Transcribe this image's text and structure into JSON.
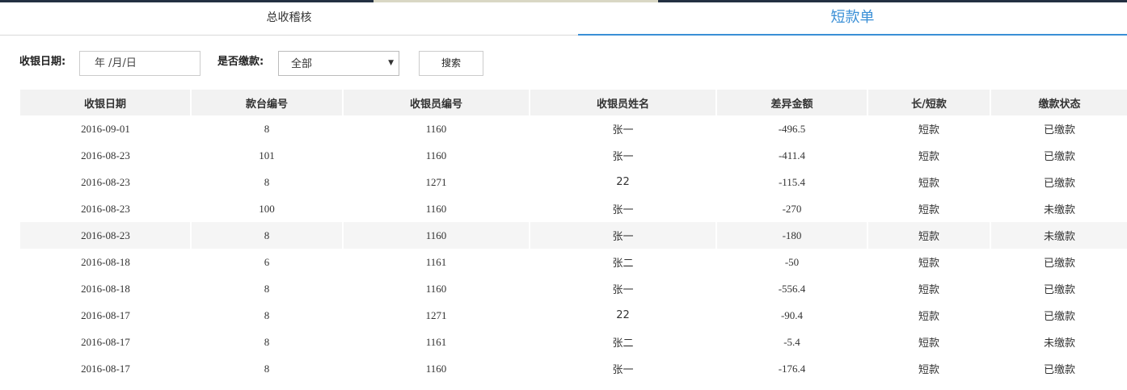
{
  "tabs": [
    {
      "label": "总收稽核",
      "active": false
    },
    {
      "label": "短款单",
      "active": true
    }
  ],
  "filters": {
    "date_label": "收银日期:",
    "date_placeholder": "年 /月/日",
    "pay_label": "是否缴款:",
    "pay_selected": "全部",
    "search_label": "搜索"
  },
  "table": {
    "headers": [
      "收银日期",
      "款台编号",
      "收银员编号",
      "收银员姓名",
      "差异金额",
      "长/短款",
      "缴款状态"
    ],
    "rows": [
      {
        "date": "2016-09-01",
        "counter": "8",
        "cashier_id": "1160",
        "cashier_name": "张一",
        "diff": "-496.5",
        "type": "短款",
        "status": "已缴款"
      },
      {
        "date": "2016-08-23",
        "counter": "101",
        "cashier_id": "1160",
        "cashier_name": "张一",
        "diff": "-411.4",
        "type": "短款",
        "status": "已缴款"
      },
      {
        "date": "2016-08-23",
        "counter": "8",
        "cashier_id": "1271",
        "cashier_name": "22",
        "diff": "-115.4",
        "type": "短款",
        "status": "已缴款"
      },
      {
        "date": "2016-08-23",
        "counter": "100",
        "cashier_id": "1160",
        "cashier_name": "张一",
        "diff": "-270",
        "type": "短款",
        "status": "未缴款"
      },
      {
        "date": "2016-08-23",
        "counter": "8",
        "cashier_id": "1160",
        "cashier_name": "张一",
        "diff": "-180",
        "type": "短款",
        "status": "未缴款"
      },
      {
        "date": "2016-08-18",
        "counter": "6",
        "cashier_id": "1161",
        "cashier_name": "张二",
        "diff": "-50",
        "type": "短款",
        "status": "已缴款"
      },
      {
        "date": "2016-08-18",
        "counter": "8",
        "cashier_id": "1160",
        "cashier_name": "张一",
        "diff": "-556.4",
        "type": "短款",
        "status": "已缴款"
      },
      {
        "date": "2016-08-17",
        "counter": "8",
        "cashier_id": "1271",
        "cashier_name": "22",
        "diff": "-90.4",
        "type": "短款",
        "status": "已缴款"
      },
      {
        "date": "2016-08-17",
        "counter": "8",
        "cashier_id": "1161",
        "cashier_name": "张二",
        "diff": "-5.4",
        "type": "短款",
        "status": "未缴款"
      },
      {
        "date": "2016-08-17",
        "counter": "8",
        "cashier_id": "1160",
        "cashier_name": "张一",
        "diff": "-176.4",
        "type": "短款",
        "status": "已缴款"
      }
    ]
  },
  "colors": {
    "accent": "#3a8fd6",
    "paid": "#19a34a",
    "unpaid": "#d0021b",
    "top_strip": "#233042"
  }
}
